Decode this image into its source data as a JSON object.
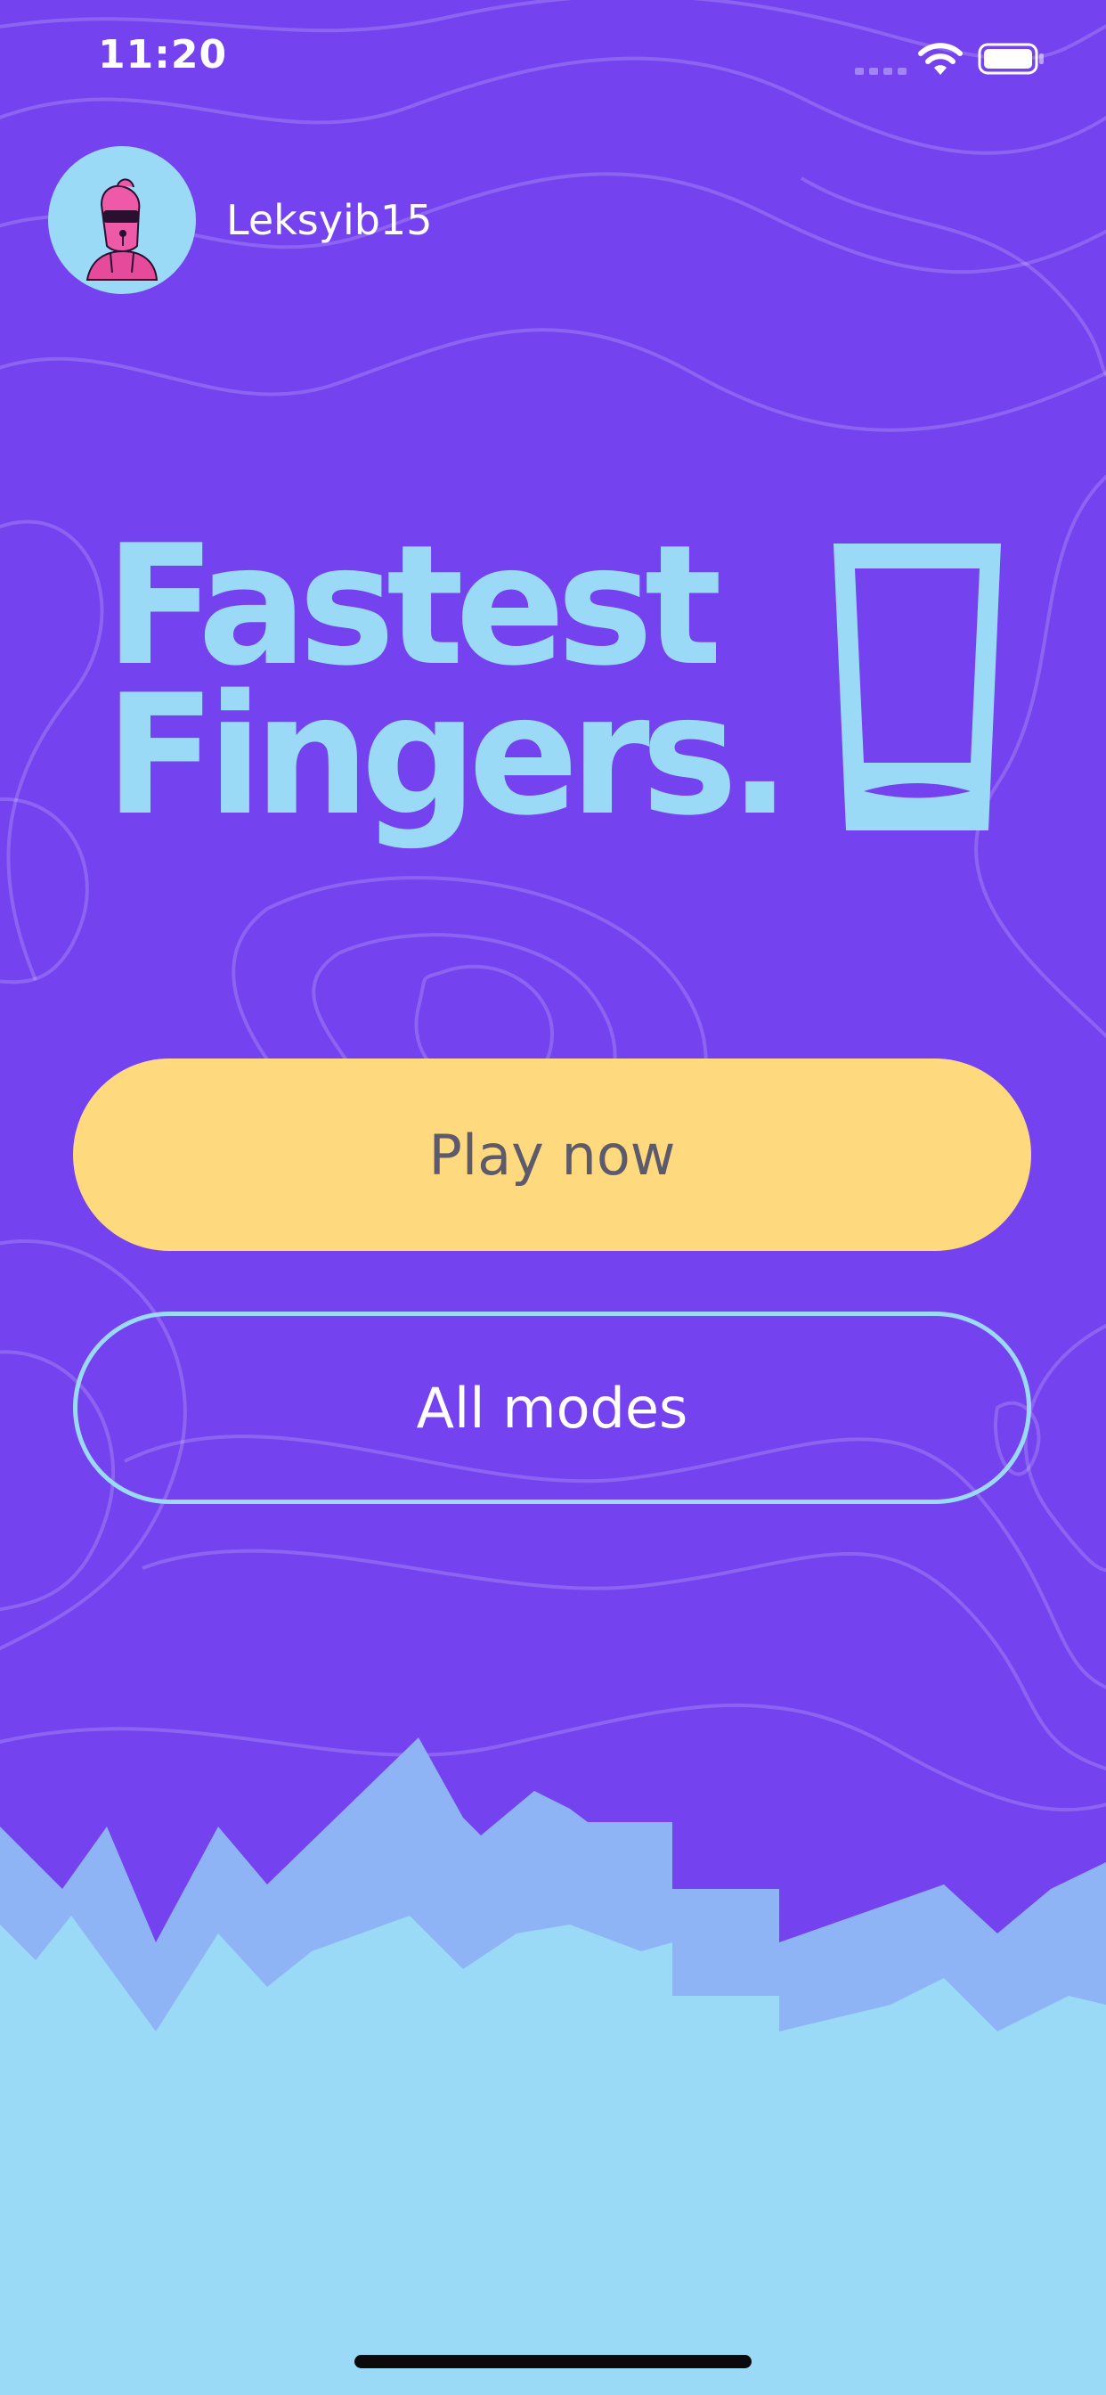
{
  "status_bar": {
    "time": "11:20"
  },
  "profile": {
    "username": "Leksyib15",
    "avatar_icon": "robot-character-icon"
  },
  "logo": {
    "line1": "Fastest",
    "line2": "Fingers.",
    "icon": "phone-icon"
  },
  "actions": {
    "play_label": "Play now",
    "modes_label": "All modes"
  },
  "colors": {
    "background": "#7442ee",
    "accent_blue": "#9adaf6",
    "play_button": "#ffd97d",
    "play_text": "#5d5a6b"
  }
}
